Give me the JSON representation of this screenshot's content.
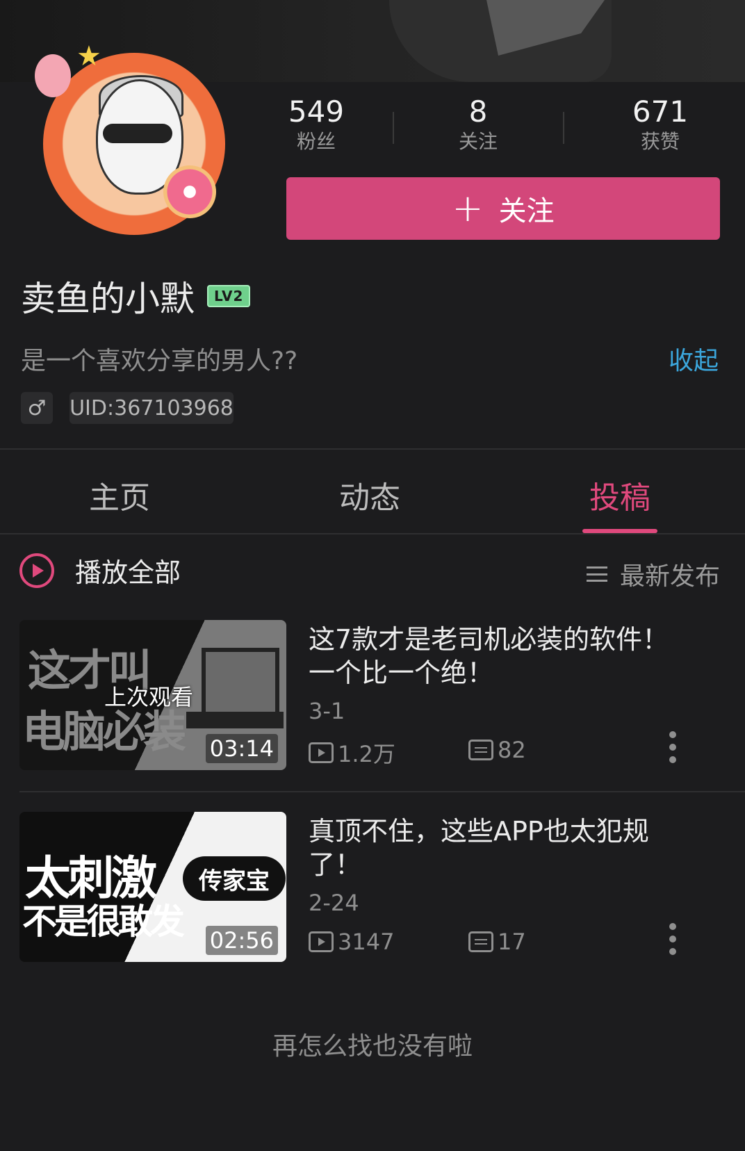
{
  "profile": {
    "name": "卖鱼的小默",
    "level_badge": "LV2",
    "bio": "是一个喜欢分享的男人??",
    "collapse_label": "收起",
    "gender_symbol": "♂",
    "uid": "UID:367103968",
    "follow_label": "关注"
  },
  "stats": {
    "fans": {
      "value": "549",
      "label": "粉丝"
    },
    "following": {
      "value": "8",
      "label": "关注"
    },
    "likes": {
      "value": "671",
      "label": "获赞"
    }
  },
  "tabs": [
    {
      "label": "主页",
      "active": false
    },
    {
      "label": "动态",
      "active": false
    },
    {
      "label": "投稿",
      "active": true
    }
  ],
  "list_header": {
    "play_all_label": "播放全部",
    "sort_label": "最新发布"
  },
  "videos": [
    {
      "title": "这7款才是老司机必装的软件！一个比一个绝！",
      "date": "3-1",
      "views": "1.2万",
      "comments": "82",
      "duration": "03:14",
      "last_watched": "上次观看",
      "thumb_line1": "这才叫",
      "thumb_line2": "电脑必装"
    },
    {
      "title": "真顶不住，这些APP也太犯规了！",
      "date": "2-24",
      "views": "3147",
      "comments": "17",
      "duration": "02:56",
      "thumb_line1": "太刺激",
      "thumb_line2": "不是很敢发",
      "thumb_badge": "传家宝"
    }
  ],
  "footer_text": "再怎么找也没有啦",
  "colors": {
    "accent": "#e0497d",
    "follow_button": "#d3477a",
    "link_blue": "#3ba6dc",
    "level_green": "#6fd08c",
    "background": "#1c1c1e"
  },
  "icons": [
    "play-circle-icon",
    "sort-list-icon",
    "male-icon",
    "plus-icon",
    "view-count-icon",
    "comment-icon",
    "more-vertical-icon"
  ]
}
